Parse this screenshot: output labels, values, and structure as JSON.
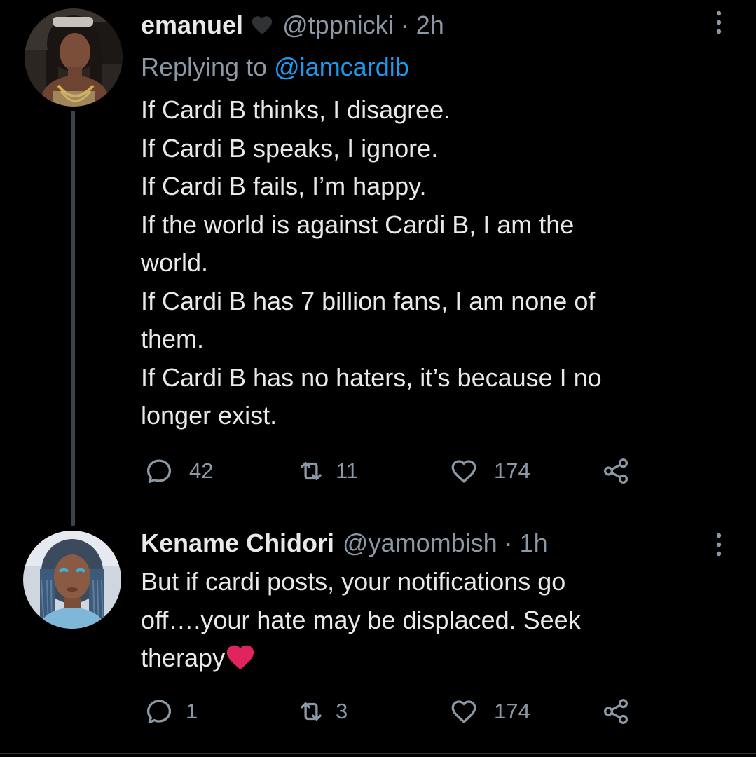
{
  "tweets": [
    {
      "author": {
        "display_name": "emanuel",
        "badge_icon": "black-heart-icon",
        "handle": "@tppnicki",
        "time": "2h"
      },
      "replying_to": {
        "prefix": "Replying to",
        "mention": "@iamcardib"
      },
      "body_lines": [
        "If Cardi B thinks, I disagree.",
        "If Cardi B speaks, I ignore.",
        "If Cardi B fails, I’m happy.",
        "If the world is against Cardi B, I am the",
        "world.",
        "If Cardi B has 7 billion fans, I am none of",
        "them.",
        "If Cardi B has no haters, it’s because I no",
        "longer exist."
      ],
      "actions": {
        "reply_count": "42",
        "retweet_count": "11",
        "like_count": "174"
      }
    },
    {
      "author": {
        "display_name": "Kename Chidori",
        "handle": "@yamombish",
        "time": "1h"
      },
      "body_lines": [
        "But if cardi posts, your notifications go",
        "off….your hate may be displaced. Seek",
        "therapy"
      ],
      "body_trailing_icon": "red-heart-emoji",
      "actions": {
        "reply_count": "1",
        "retweet_count": "3",
        "like_count": "174"
      }
    }
  ],
  "separator": "·",
  "icons": {
    "reply": "reply-icon",
    "retweet": "retweet-icon",
    "like": "like-icon",
    "share": "share-icon",
    "more": "more-options-icon"
  },
  "colors": {
    "background": "#000000",
    "text_primary": "#e7e9ea",
    "text_secondary": "#8b98a5",
    "link": "#1d9bf0",
    "heart_red": "#e0245e",
    "thread_line": "#38444d"
  }
}
